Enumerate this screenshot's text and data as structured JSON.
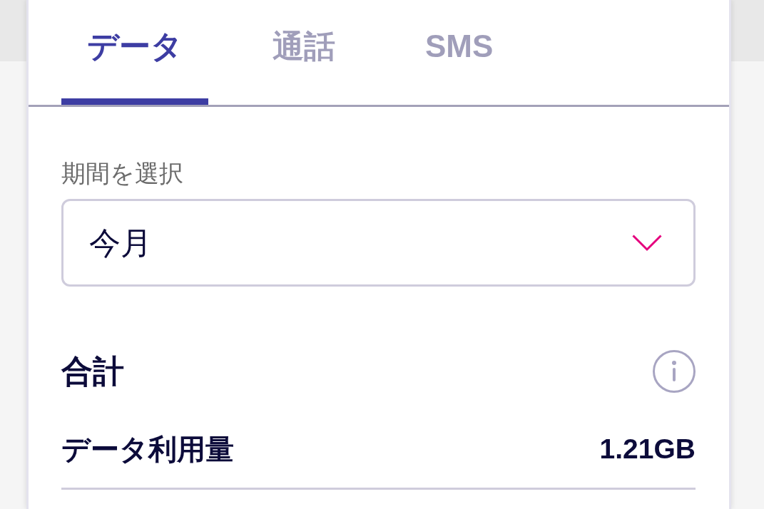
{
  "tabs": [
    {
      "label": "データ",
      "selected": true
    },
    {
      "label": "通話",
      "selected": false
    },
    {
      "label": "SMS",
      "selected": false
    }
  ],
  "period_select": {
    "label": "期間を選択",
    "value": "今月"
  },
  "summary": {
    "title": "合計",
    "rows": [
      {
        "label": "データ利用量",
        "value": "1.21GB"
      }
    ]
  }
}
